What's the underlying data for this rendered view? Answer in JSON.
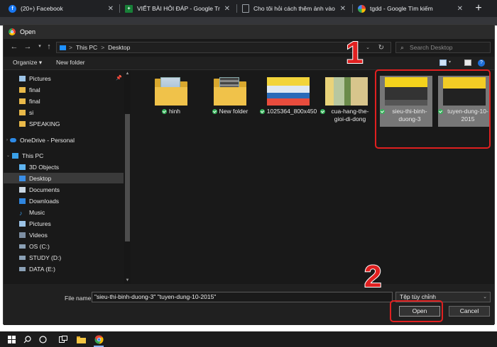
{
  "browser": {
    "tabs": [
      {
        "title": "(20+) Facebook",
        "icon": "facebook-icon",
        "color": "#1877f2"
      },
      {
        "title": "VIẾT BÀI HỎI ĐÁP - Google Trang tính",
        "icon": "sheets-icon",
        "color": "#188038"
      },
      {
        "title": "Cho tôi hỏi cách thêm ảnh vào a",
        "icon": "doc-icon",
        "color": "#5f6368"
      },
      {
        "title": "tgdd - Google Tìm kiếm",
        "icon": "google-icon",
        "color": "#ffffff"
      }
    ],
    "new_tab": "+"
  },
  "dialog": {
    "title": "Open",
    "address": [
      "This PC",
      ">",
      "Desktop"
    ],
    "search_placeholder": "Search Desktop",
    "toolbar": {
      "organize": "Organize ▾",
      "new_folder": "New folder"
    },
    "nav_items": [
      {
        "label": "Pictures",
        "icon": "pictures-icon",
        "indent": 1
      },
      {
        "label": "final",
        "icon": "folder-icon",
        "indent": 1
      },
      {
        "label": "final",
        "icon": "folder-icon",
        "indent": 1
      },
      {
        "label": "si",
        "icon": "folder-icon",
        "indent": 1
      },
      {
        "label": "SPEAKING",
        "icon": "folder-icon",
        "indent": 1
      },
      {
        "label": "OneDrive - Personal",
        "icon": "cloud-icon",
        "indent": 0
      },
      {
        "label": "This PC",
        "icon": "pc-icon",
        "indent": 0
      },
      {
        "label": "3D Objects",
        "icon": "cube-icon",
        "indent": 1
      },
      {
        "label": "Desktop",
        "icon": "desktop-icon",
        "indent": 1,
        "selected": true
      },
      {
        "label": "Documents",
        "icon": "documents-icon",
        "indent": 1
      },
      {
        "label": "Downloads",
        "icon": "downloads-icon",
        "indent": 1
      },
      {
        "label": "Music",
        "icon": "music-icon",
        "indent": 1
      },
      {
        "label": "Pictures",
        "icon": "pictures-icon",
        "indent": 1
      },
      {
        "label": "Videos",
        "icon": "videos-icon",
        "indent": 1
      },
      {
        "label": "OS (C:)",
        "icon": "drive-icon",
        "indent": 1
      },
      {
        "label": "STUDY (D:)",
        "icon": "drive-icon",
        "indent": 1
      },
      {
        "label": "DATA (E:)",
        "icon": "drive-icon",
        "indent": 1
      }
    ],
    "files": [
      {
        "name": "hinh",
        "kind": "folder"
      },
      {
        "name": "New folder",
        "kind": "folder"
      },
      {
        "name": "1025364_800x450",
        "kind": "photo"
      },
      {
        "name": "cua-hang-the-gioi-di-dong",
        "kind": "photo"
      },
      {
        "name": "sieu-thi-binh-duong-3",
        "kind": "photo",
        "selected": true
      },
      {
        "name": "tuyen-dung-10-2015",
        "kind": "photo",
        "selected": true
      }
    ],
    "file_name_label": "File name:",
    "file_name_value": "\"sieu-thi-binh-duong-3\" \"tuyen-dung-10-2015\"",
    "file_type": "Tệp tùy chỉnh",
    "open_label": "Open",
    "cancel_label": "Cancel"
  },
  "annotations": {
    "step1": "1",
    "step2": "2",
    "color": "#e02020"
  },
  "taskbar": {
    "icons": [
      "windows-icon",
      "search-icon",
      "task-view-icon",
      "file-explorer-icon",
      "chrome-icon"
    ]
  }
}
